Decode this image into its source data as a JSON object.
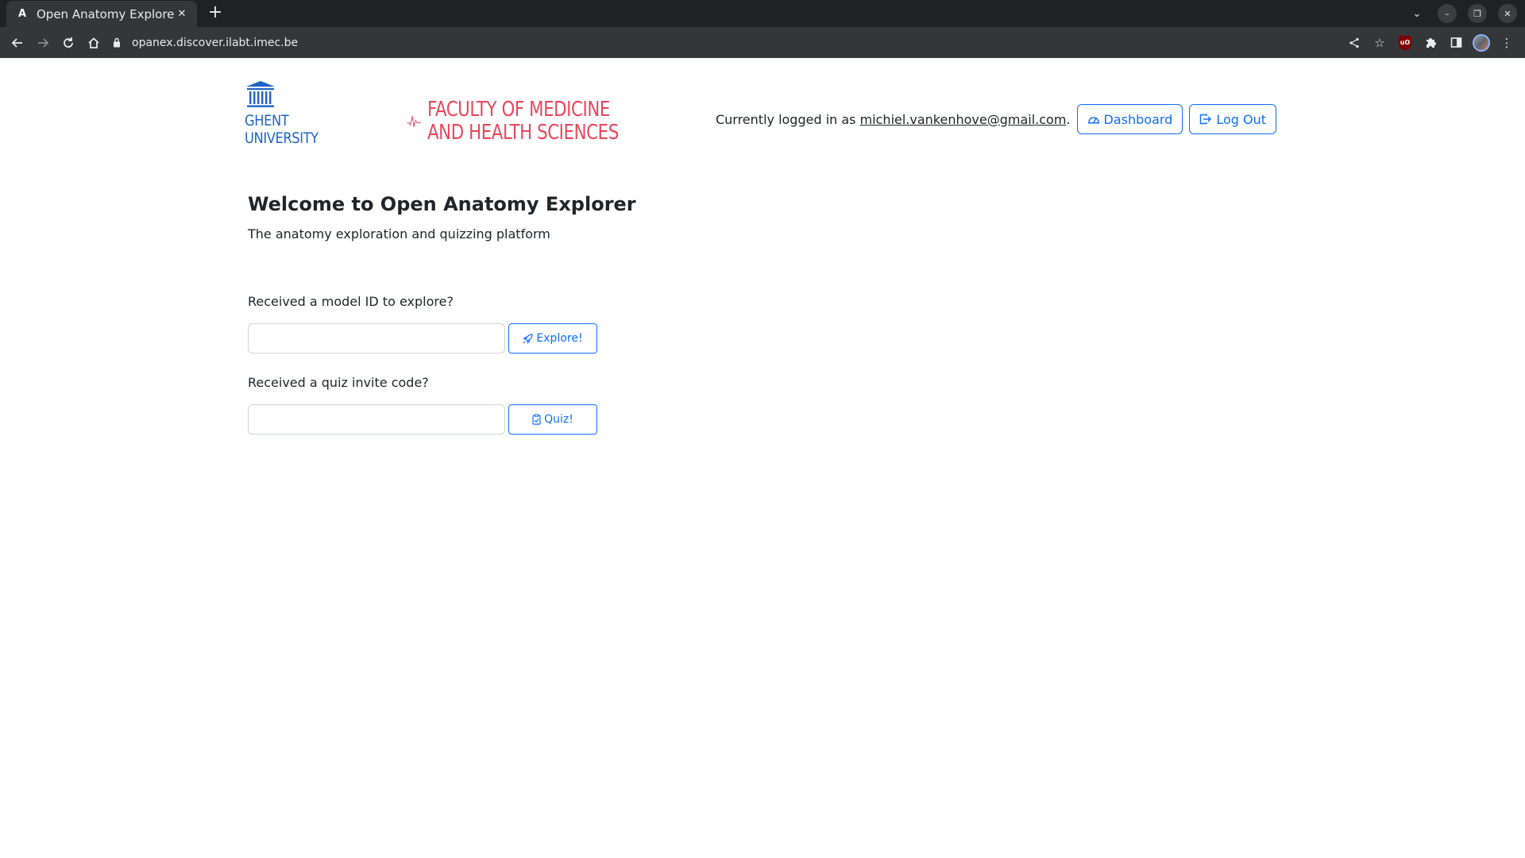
{
  "browser": {
    "tab": {
      "title": "Open Anatomy Explorer",
      "favicon": "A"
    },
    "url": "opanex.discover.ilabt.imec.be",
    "icons": [
      "back-icon",
      "forward-icon",
      "reload-icon",
      "home-icon",
      "lock-icon",
      "share-icon",
      "star-icon",
      "ublock-icon",
      "puzzle-icon",
      "side-panel-icon",
      "profile-avatar",
      "kebab-menu-icon"
    ]
  },
  "header": {
    "ugent_logo": {
      "line1": "GHENT",
      "line2": "UNIVERSITY",
      "color": "#1e64c8"
    },
    "faculty_logo": {
      "line1": "FACULTY OF MEDICINE",
      "line2": "AND HEALTH SCIENCES",
      "color": "#e8475c"
    },
    "user": {
      "prefix": "Currently logged in as ",
      "email": "michiel.vankenhove@gmail.com",
      "suffix": ".",
      "dashboard_label": "Dashboard",
      "logout_label": "Log Out"
    }
  },
  "main": {
    "title": "Welcome to Open Anatomy Explorer",
    "subtitle": "The anatomy exploration and quizzing platform",
    "model_section": {
      "label": "Received a model ID to explore?",
      "input_value": "",
      "button_label": "Explore!"
    },
    "quiz_section": {
      "label": "Received a quiz invite code?",
      "input_value": "",
      "button_label": "Quiz!"
    }
  },
  "colors": {
    "primary": "#0d6efd",
    "text": "#212529",
    "chrome_dark": "#202124",
    "chrome_toolbar": "#35363a"
  }
}
